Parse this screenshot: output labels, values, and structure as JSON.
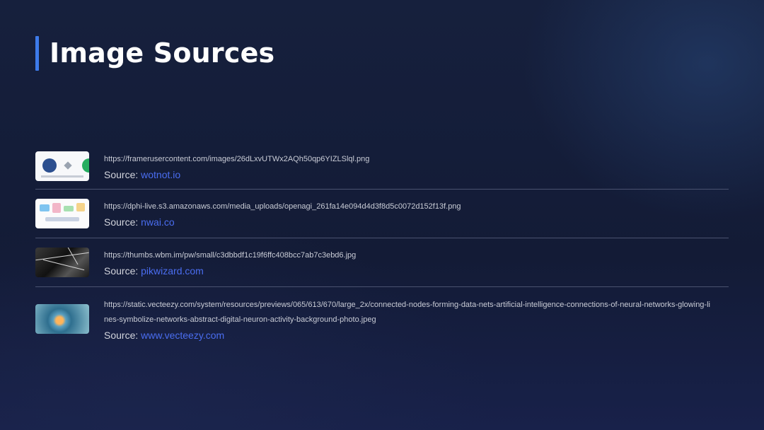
{
  "title": "Image Sources",
  "source_prefix": "Source: ",
  "sources": [
    {
      "url": "https://framerusercontent.com/images/26dLxvUTWx2AQh50qp6YIZLSlql.png",
      "source": "wotnot.io"
    },
    {
      "url": "https://dphi-live.s3.amazonaws.com/media_uploads/openagi_261fa14e094d4d3f8d5c0072d152f13f.png",
      "source": "nwai.co"
    },
    {
      "url": "https://thumbs.wbm.im/pw/small/c3dbbdf1c19f6ffc408bcc7ab7c3ebd6.jpg",
      "source": "pikwizard.com"
    },
    {
      "url": "https://static.vecteezy.com/system/resources/previews/065/613/670/large_2x/connected-nodes-forming-data-nets-artificial-intelligence-connections-of-neural-networks-glowing-lines-symbolize-networks-abstract-digital-neuron-activity-background-photo.jpeg",
      "source": "www.vecteezy.com"
    }
  ],
  "colors": {
    "accent": "#3d7bea",
    "link": "#4a6df0",
    "background": "#141d38"
  }
}
